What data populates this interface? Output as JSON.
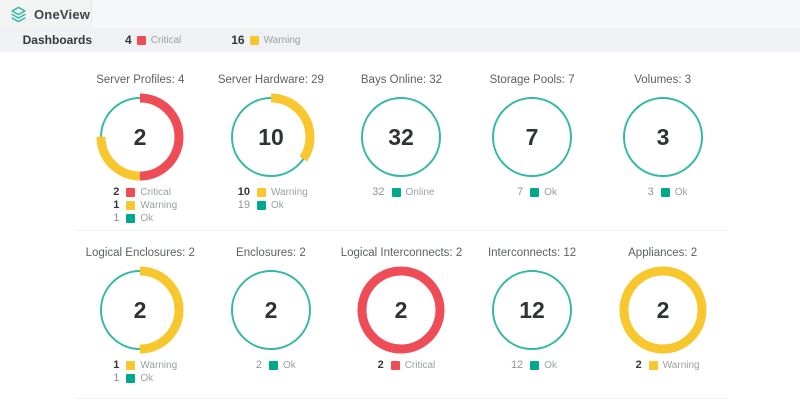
{
  "header": {
    "app_title": "OneView"
  },
  "toolbar": {
    "nav_label": "Dashboards",
    "badges": [
      {
        "count": "4",
        "status": "critical",
        "label": "Critical"
      },
      {
        "count": "16",
        "status": "warning",
        "label": "Warning"
      }
    ]
  },
  "colors": {
    "critical": "#ee4c56",
    "warning": "#f7c72d",
    "ok": "#00a98c",
    "ring_base": "#35b8a4",
    "brand": "#2bb9a2"
  },
  "charts": [
    {
      "title": "Server Profiles: 4",
      "center": "2",
      "segments": [
        {
          "value": 2,
          "status": "critical",
          "label": "Critical"
        },
        {
          "value": 1,
          "status": "warning",
          "label": "Warning"
        },
        {
          "value": 1,
          "status": "ok",
          "label": "Ok"
        }
      ]
    },
    {
      "title": "Server Hardware: 29",
      "center": "10",
      "segments": [
        {
          "value": 10,
          "status": "warning",
          "label": "Warning"
        },
        {
          "value": 19,
          "status": "ok",
          "label": "Ok"
        }
      ]
    },
    {
      "title": "Bays Online: 32",
      "center": "32",
      "segments": [
        {
          "value": 32,
          "status": "ok",
          "label": "Online"
        }
      ]
    },
    {
      "title": "Storage Pools: 7",
      "center": "7",
      "segments": [
        {
          "value": 7,
          "status": "ok",
          "label": "Ok"
        }
      ]
    },
    {
      "title": "Volumes: 3",
      "center": "3",
      "segments": [
        {
          "value": 3,
          "status": "ok",
          "label": "Ok"
        }
      ]
    },
    {
      "title": "Logical Enclosures: 2",
      "center": "2",
      "segments": [
        {
          "value": 1,
          "status": "warning",
          "label": "Warning"
        },
        {
          "value": 1,
          "status": "ok",
          "label": "Ok"
        }
      ]
    },
    {
      "title": "Enclosures: 2",
      "center": "2",
      "segments": [
        {
          "value": 2,
          "status": "ok",
          "label": "Ok"
        }
      ]
    },
    {
      "title": "Logical Interconnects: 2",
      "center": "2",
      "segments": [
        {
          "value": 2,
          "status": "critical",
          "label": "Critical"
        }
      ]
    },
    {
      "title": "Interconnects: 12",
      "center": "12",
      "segments": [
        {
          "value": 12,
          "status": "ok",
          "label": "Ok"
        }
      ]
    },
    {
      "title": "Appliances: 2",
      "center": "2",
      "segments": [
        {
          "value": 2,
          "status": "warning",
          "label": "Warning"
        }
      ]
    }
  ],
  "layout": {
    "row_split": 5
  }
}
